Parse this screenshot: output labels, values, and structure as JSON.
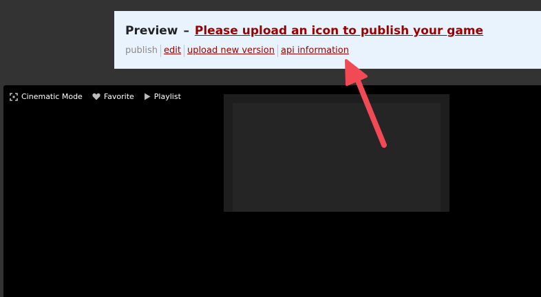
{
  "banner": {
    "label": "Preview",
    "separator": "–",
    "link_text": "Please upload an icon to publish your game",
    "actions": [
      {
        "label": "publish"
      },
      {
        "label": "edit"
      },
      {
        "label": "upload new version"
      },
      {
        "label": "api information"
      }
    ]
  },
  "toolbar": {
    "cinematic": {
      "label": "Cinematic Mode",
      "icon": "expand-icon"
    },
    "favorite": {
      "label": "Favorite",
      "icon": "heart-icon"
    },
    "playlist": {
      "label": "Playlist",
      "icon": "play-icon"
    }
  },
  "colors": {
    "banner_bg": "#e8f3fd",
    "link": "#9a0000",
    "arrow": "#f24a55",
    "page_bg": "#333333",
    "frame_bg": "#000000"
  }
}
